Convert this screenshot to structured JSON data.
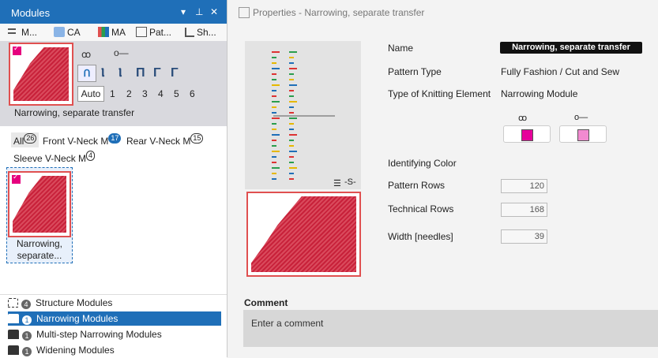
{
  "left_panel": {
    "title": "Modules",
    "pin_glyph": "▾ ⊥ ✕",
    "tabs": [
      {
        "label": "M...",
        "icon": "modules-icon"
      },
      {
        "label": "CA",
        "icon": "ca-icon"
      },
      {
        "label": "MA",
        "icon": "ma-icon"
      },
      {
        "label": "Pat...",
        "icon": "pattern-icon"
      },
      {
        "label": "Sh...",
        "icon": "shape-icon"
      }
    ],
    "preview": {
      "caption": "Narrowing, separate transfer",
      "auto_label": "Auto",
      "numbers": [
        "1",
        "2",
        "3",
        "4",
        "5",
        "6"
      ]
    },
    "filters": [
      {
        "label": "All",
        "count": "26"
      },
      {
        "label": "Front V-Neck M",
        "count": "17"
      },
      {
        "label": "Rear V-Neck M",
        "count": "15"
      },
      {
        "label": "Sleeve V-Neck M",
        "count": "4"
      }
    ],
    "grid_item": {
      "caption_line1": "Narrowing,",
      "caption_line2": "separate..."
    },
    "tree": [
      {
        "label": "Structure Modules",
        "count": "4",
        "selected": false
      },
      {
        "label": "Narrowing Modules",
        "count": "1",
        "selected": true
      },
      {
        "label": "Multi-step Narrowing Modules",
        "count": "1",
        "selected": false
      },
      {
        "label": "Widening Modules",
        "count": "1",
        "selected": false
      }
    ]
  },
  "right_panel": {
    "title": "Properties - Narrowing, separate transfer",
    "fields": {
      "name_label": "Name",
      "name_value": "Narrowing, separate transfer",
      "pattern_type_label": "Pattern Type",
      "pattern_type_value": "Fully Fashion / Cut and Sew",
      "knitting_element_label": "Type of Knitting Element",
      "knitting_element_value": "Narrowing Module",
      "identifying_color_label": "Identifying Color",
      "pattern_rows_label": "Pattern Rows",
      "pattern_rows_value": "120",
      "technical_rows_label": "Technical Rows",
      "technical_rows_value": "168",
      "width_label": "Width [needles]",
      "width_value": "39"
    },
    "colors": {
      "swatch1": "#e6009a",
      "swatch2": "#f28ad0"
    },
    "comment": {
      "label": "Comment",
      "placeholder": "Enter a comment"
    }
  }
}
